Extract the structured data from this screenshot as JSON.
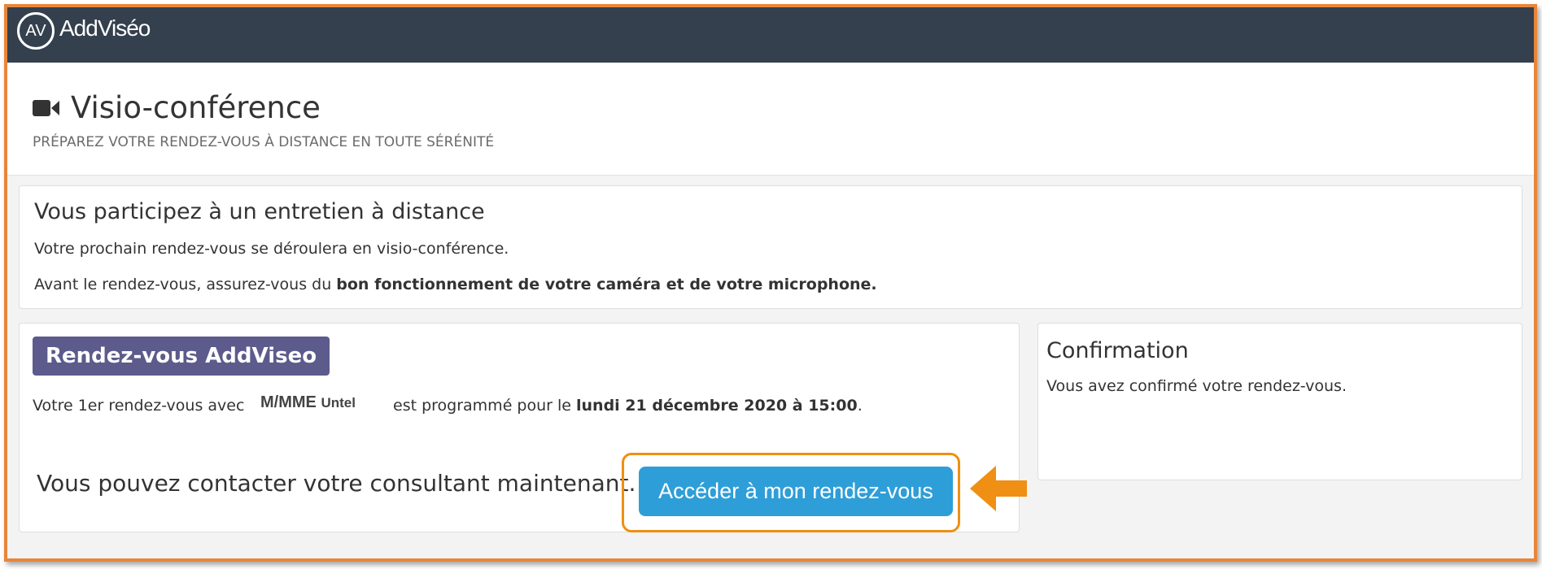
{
  "app": {
    "logo_mark": "AV",
    "logo_text": "AddViséo"
  },
  "header": {
    "icon": "video-camera-icon",
    "title": "Visio-conférence",
    "subtitle": "PRÉPAREZ VOTRE RENDEZ-VOUS À DISTANCE EN TOUTE SÉRÉNITÉ"
  },
  "intro": {
    "heading": "Vous participez à un entretien à distance",
    "line1": "Votre prochain rendez-vous se déroulera en visio-conférence.",
    "line2_prefix": "Avant le rendez-vous, assurez-vous du ",
    "line2_bold": "bon fonctionnement de votre caméra et de votre microphone."
  },
  "appointment": {
    "badge": "Rendez-vous AddViseo",
    "prefix": "Votre 1er rendez-vous avec",
    "person_title": "M/MME",
    "person_name": "Untel",
    "middle": "est programmé pour le ",
    "date": "lundi 21 décembre 2020 à 15:00",
    "suffix": ".",
    "contact_text": "Vous pouvez contacter votre consultant maintenant.",
    "button_label": "Accéder à mon rendez-vous"
  },
  "confirmation": {
    "heading": "Confirmation",
    "text": "Vous avez confirmé votre rendez-vous."
  },
  "colors": {
    "topbar": "#34404d",
    "frame_border": "#e8853a",
    "badge": "#5c5b8c",
    "button": "#2e9ed8",
    "highlight": "#ef8f13"
  }
}
